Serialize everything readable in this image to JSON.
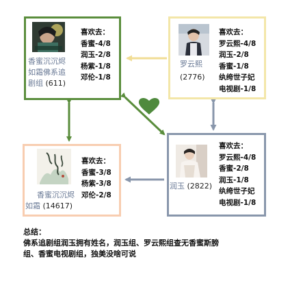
{
  "nodes": {
    "top_left": {
      "caption_line1": "香蜜沉沉烬",
      "caption_line2": "如霜佛系追",
      "caption_line3": "剧组",
      "count": "(611)",
      "likes_header": "喜欢去：",
      "likes": [
        "香蜜-4/8",
        "润玉-2/8",
        "杨紫-1/8",
        "邓伦-1/8"
      ]
    },
    "top_right": {
      "caption_line1": "罗云熙",
      "count": "(2776)",
      "likes_header": "喜欢去：",
      "likes": [
        "罗云熙-4/8",
        "润玉-2/8",
        "香蜜-1/8",
        "纨绔世子妃",
        "电视剧-1/8"
      ]
    },
    "bottom_left": {
      "caption_line1": "香蜜沉沉烬",
      "caption_line2": "如霜",
      "count": "(14617)",
      "likes_header": "喜欢去：",
      "likes": [
        "香蜜-3/8",
        "杨紫-3/8",
        "邓伦-2/8"
      ]
    },
    "bottom_right": {
      "caption_line1": "润玉",
      "count": "(2822)",
      "likes_header": "喜欢去：",
      "likes": [
        "罗云熙-4/8",
        "香蜜-2/8",
        "润玉-1/8",
        "纨绔世子妃",
        "电视剧-1/8"
      ]
    }
  },
  "summary": {
    "title": "总结：",
    "line1": "佛系追剧组润玉拥有姓名，润玉组、罗云熙组查无香蜜斯膀",
    "line2": "组、香蜜电视剧组，独美没啥可说"
  },
  "colors": {
    "green": "#5a8d3c",
    "yellow": "#f3e6a8",
    "peach": "#f8cdb0",
    "slate": "#8896ab",
    "heart": "#4f8a3d"
  }
}
